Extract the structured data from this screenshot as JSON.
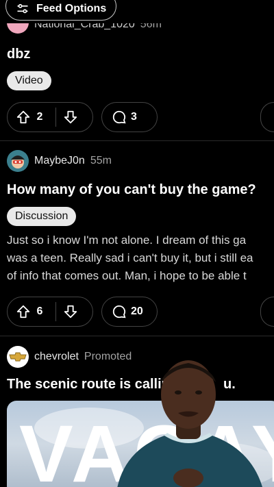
{
  "feed_options": {
    "label": "Feed Options",
    "icon": "sliders-icon"
  },
  "posts": [
    {
      "author": "National_Crab_1020",
      "time": "56m",
      "title": "dbz",
      "flair": "Video",
      "score": "2",
      "comments": "3"
    },
    {
      "author": "MaybeJ0n",
      "time": "55m",
      "title": "How many of you can't buy the game?",
      "flair": "Discussion",
      "body_lines": [
        "Just so i know I'm not alone. I dream of this ga",
        "was a teen. Really sad i can't buy it, but i still ea",
        "of info that comes out. Man, i hope to be able t"
      ],
      "score": "6",
      "comments": "20"
    },
    {
      "author": "chevrolet",
      "tag": "Promoted",
      "title": "The scenic route is calling u",
      "title_end": "u.",
      "image_text": "VACAY"
    }
  ],
  "colors": {
    "background": "#000000",
    "pill_border": "#444444",
    "flair_bg": "#e9e9e9"
  }
}
